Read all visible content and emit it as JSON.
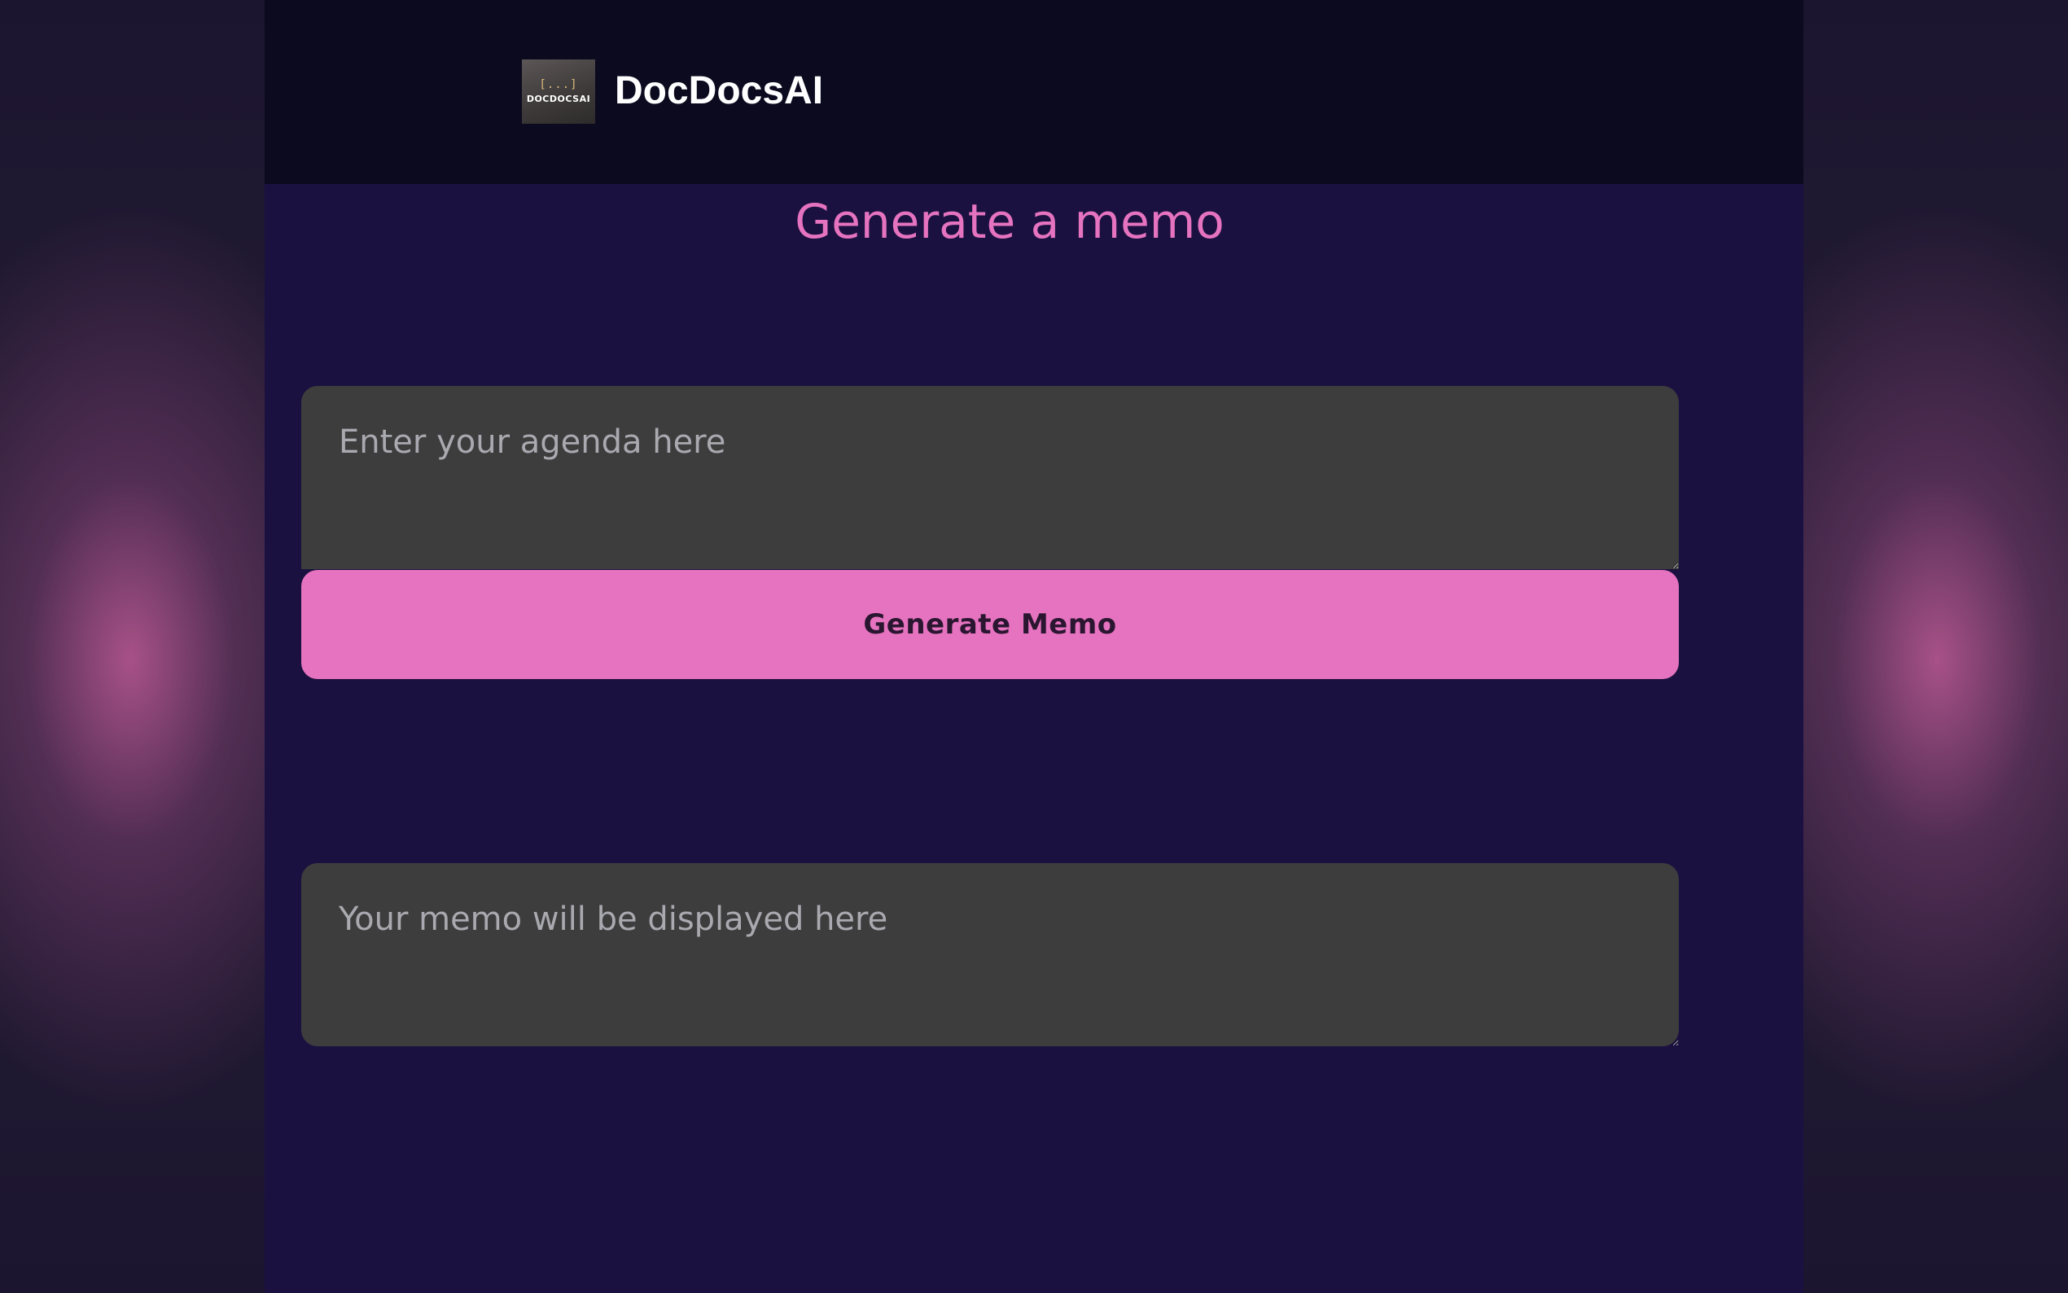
{
  "header": {
    "logo": {
      "glyph": "[...]",
      "text": "DOCDOCSAI"
    },
    "brand_name": "DocDocsAI"
  },
  "main": {
    "title": "Generate a memo",
    "agenda_input": {
      "placeholder": "Enter your agenda here",
      "value": ""
    },
    "generate_button_label": "Generate Memo",
    "memo_output": {
      "placeholder": "Your memo will be displayed here",
      "value": ""
    }
  },
  "colors": {
    "accent": "#e673bf",
    "header_bg": "#0c0a1f",
    "app_bg": "#1b1140",
    "field_bg": "#3d3d3d"
  }
}
